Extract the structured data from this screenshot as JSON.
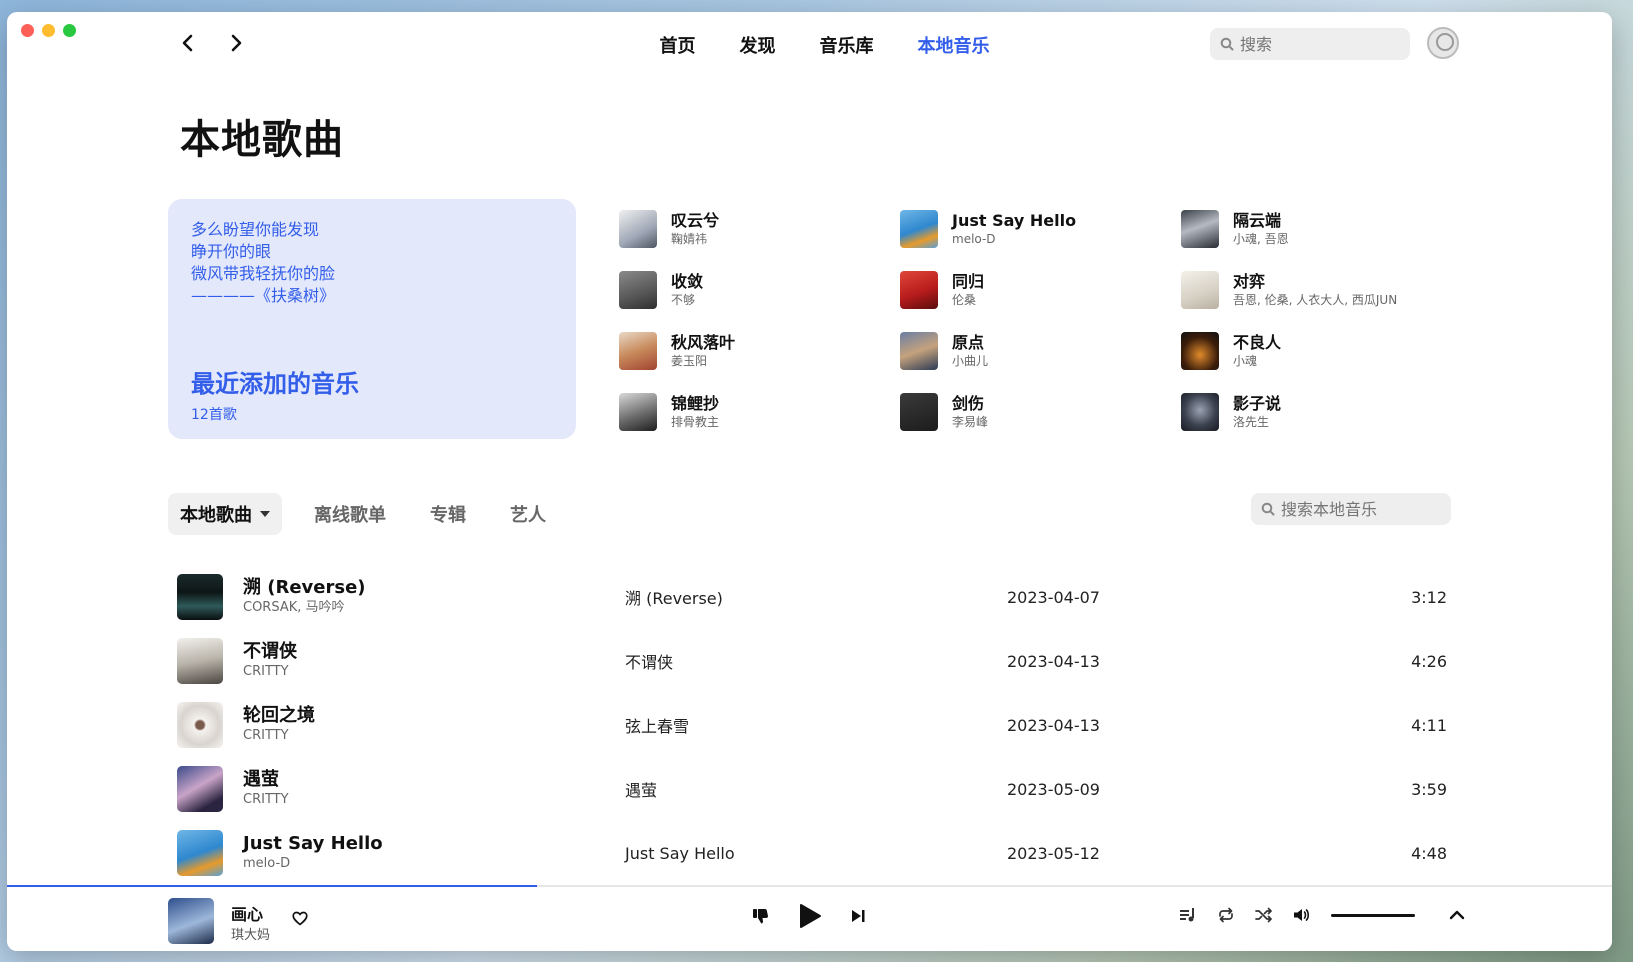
{
  "nav": {
    "back_icon": "chevron-left-icon",
    "forward_icon": "chevron-right-icon",
    "items": [
      {
        "label": "首页",
        "active": false
      },
      {
        "label": "发现",
        "active": false
      },
      {
        "label": "音乐库",
        "active": false
      },
      {
        "label": "本地音乐",
        "active": true
      }
    ],
    "search_placeholder": "搜索"
  },
  "colors": {
    "accent": "#335eea",
    "card_bg": "#e3e8fb"
  },
  "page": {
    "title": "本地歌曲"
  },
  "feature": {
    "lyrics": [
      "多么盼望你能发现",
      "睁开你的眼",
      "微风带我轻抚你的脸",
      "————《扶桑树》"
    ],
    "title": "最近添加的音乐",
    "count": "12首歌"
  },
  "recent": [
    {
      "name": "叹云兮",
      "artist": "鞠婧祎"
    },
    {
      "name": "Just Say Hello",
      "artist": "melo-D"
    },
    {
      "name": "隔云端",
      "artist": "小魂, 吾恩"
    },
    {
      "name": "收敛",
      "artist": "不够"
    },
    {
      "name": "同归",
      "artist": "伦桑"
    },
    {
      "name": "对弈",
      "artist": "吾恩, 伦桑, 人衣大人, 西瓜JUN"
    },
    {
      "name": "秋风落叶",
      "artist": "姜玉阳"
    },
    {
      "name": "原点",
      "artist": "小曲儿"
    },
    {
      "name": "不良人",
      "artist": "小魂"
    },
    {
      "name": "锦鲤抄",
      "artist": "排骨教主"
    },
    {
      "name": "剑伤",
      "artist": "李易峰"
    },
    {
      "name": "影子说",
      "artist": "洛先生"
    }
  ],
  "tabs": {
    "items": [
      "本地歌曲",
      "离线歌单",
      "专辑",
      "艺人"
    ],
    "search_placeholder": "搜索本地音乐"
  },
  "songs": [
    {
      "name": "溯 (Reverse)",
      "artist": "CORSAK, 马吟吟",
      "album": "溯 (Reverse)",
      "date": "2023-04-07",
      "duration": "3:12"
    },
    {
      "name": "不谓侠",
      "artist": "CRITTY",
      "album": "不谓侠",
      "date": "2023-04-13",
      "duration": "4:26"
    },
    {
      "name": "轮回之境",
      "artist": "CRITTY",
      "album": "弦上春雪",
      "date": "2023-04-13",
      "duration": "4:11"
    },
    {
      "name": "遇萤",
      "artist": "CRITTY",
      "album": "遇萤",
      "date": "2023-05-09",
      "duration": "3:59"
    },
    {
      "name": "Just Say Hello",
      "artist": "melo-D",
      "album": "Just Say Hello",
      "date": "2023-05-12",
      "duration": "4:48"
    }
  ],
  "player": {
    "title": "画心",
    "artist": "琪大妈",
    "progress": 0.33,
    "volume": 1.0
  }
}
